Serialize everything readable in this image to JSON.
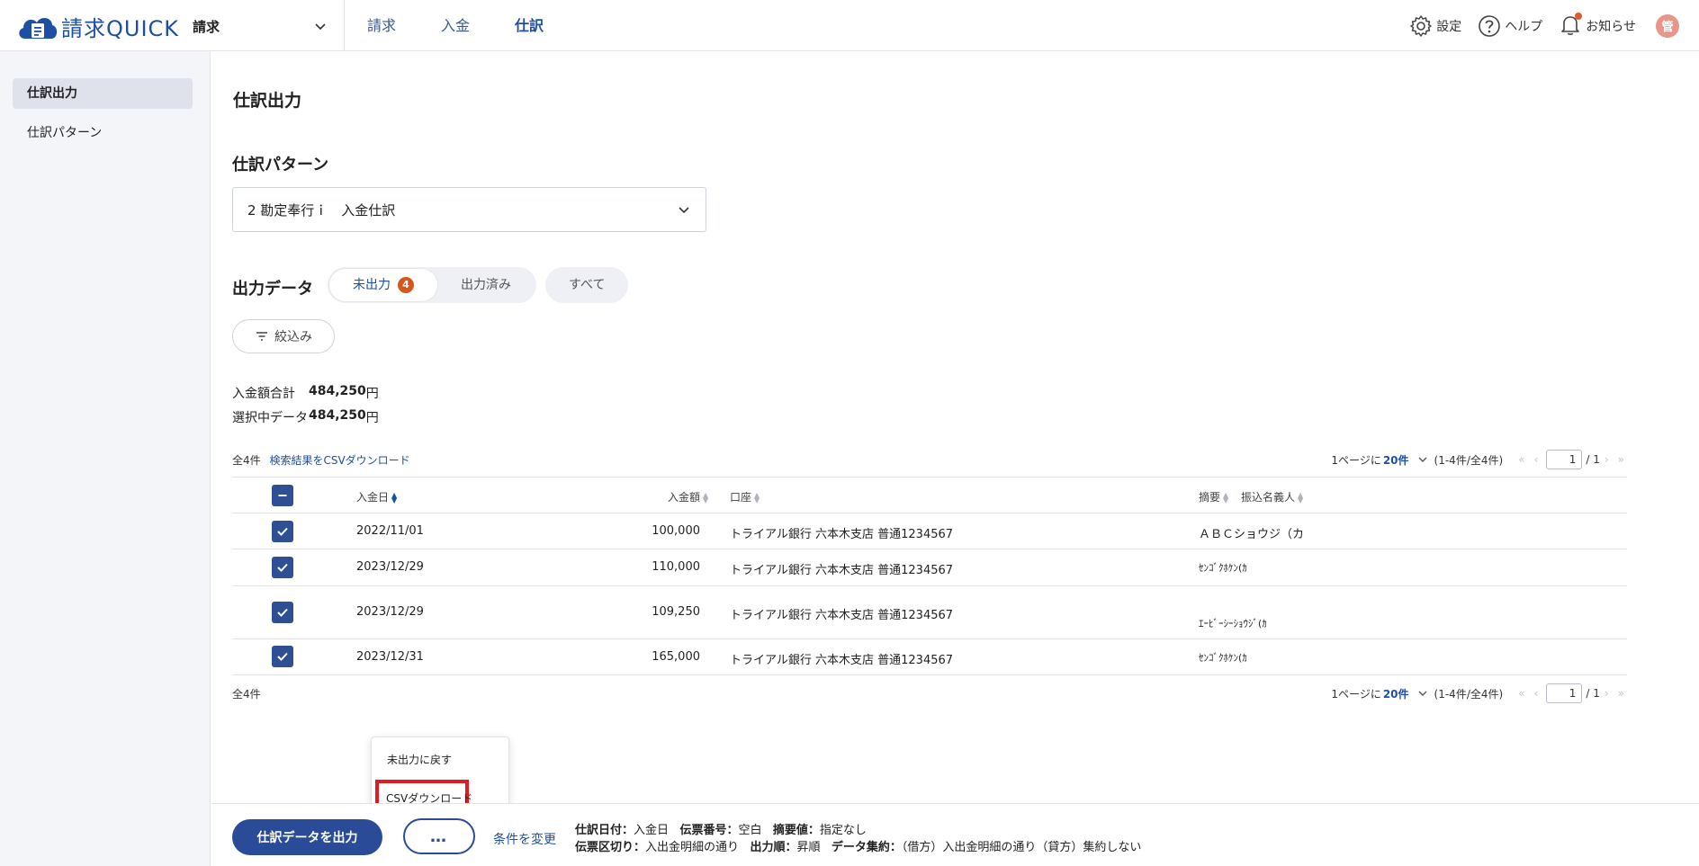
{
  "header": {
    "logo_text": "請求QUICK",
    "app_select": "請求",
    "nav": [
      "請求",
      "入金",
      "仕訳"
    ],
    "nav_active": "仕訳",
    "settings": "設定",
    "help": "ヘルプ",
    "notifications": "お知らせ",
    "avatar": "管",
    "brand_color": "#1f4fa3"
  },
  "sidebar": {
    "items": [
      {
        "label": "仕訳出力",
        "active": true
      },
      {
        "label": "仕訳パターン",
        "active": false
      }
    ]
  },
  "main": {
    "title": "仕訳出力",
    "pattern_title": "仕訳パターン",
    "pattern_value": "2 勘定奉行ｉ　入金仕訳",
    "output_title": "出力データ",
    "tabs": {
      "unexported": "未出力",
      "unexported_count": "4",
      "exported": "出力済み",
      "all": "すべて"
    },
    "filter_label": "絞込み",
    "summary": {
      "total_label": "入金額合計",
      "total_value": "484,250",
      "selected_label": "選択中データ",
      "selected_value": "484,250",
      "unit": "円"
    },
    "count_label": "全4件",
    "csv_link": "検索結果をCSVダウンロード",
    "pager": {
      "per_page_prefix": "1ページに",
      "per_page_value": "20件",
      "range": "(1-4件/全4件)",
      "current_page": "1",
      "total_pages": "/ 1"
    },
    "table": {
      "columns": {
        "date": "入金日",
        "amount": "入金額",
        "account": "口座",
        "summary": "摘要",
        "payer": "振込名義人"
      },
      "rows": [
        {
          "date": "2022/11/01",
          "amount": "100,000",
          "account": "トライアル銀行 六本木支店 普通1234567",
          "payer": "ＡＢＣショウジ（カ",
          "checked": true
        },
        {
          "date": "2023/12/29",
          "amount": "110,000",
          "account": "トライアル銀行 六本木支店 普通1234567",
          "payer": "ｾﾝｺﾞｸﾎｹﾝ(ｶ",
          "checked": true
        },
        {
          "date": "2023/12/29",
          "amount": "109,250",
          "account": "トライアル銀行 六本木支店 普通1234567",
          "payer": "ｴｰﾋﾞｰｼｰｼｮｳｼﾞ(ｶ",
          "checked": true
        },
        {
          "date": "2023/12/31",
          "amount": "165,000",
          "account": "トライアル銀行 六本木支店 普通1234567",
          "payer": "ｾﾝｺﾞｸﾎｹﾝ(ｶ",
          "checked": true
        }
      ]
    },
    "bottom_count_label": "全4件"
  },
  "popup": {
    "items": [
      "未出力に戻す",
      "CSVダウンロード"
    ]
  },
  "footer": {
    "primary_button": "仕訳データを出力",
    "more_button": "…",
    "change_link": "条件を変更",
    "line1": [
      {
        "key": "仕訳日付：",
        "value": "入金日"
      },
      {
        "key": "伝票番号：",
        "value": "空白"
      },
      {
        "key": "摘要値：",
        "value": "指定なし"
      }
    ],
    "line2": [
      {
        "key": "伝票区切り：",
        "value": "入出金明細の通り"
      },
      {
        "key": "出力順：",
        "value": "昇順"
      },
      {
        "key": "データ集約：",
        "value": "（借方）入出金明細の通り（貸方）集約しない"
      }
    ]
  }
}
